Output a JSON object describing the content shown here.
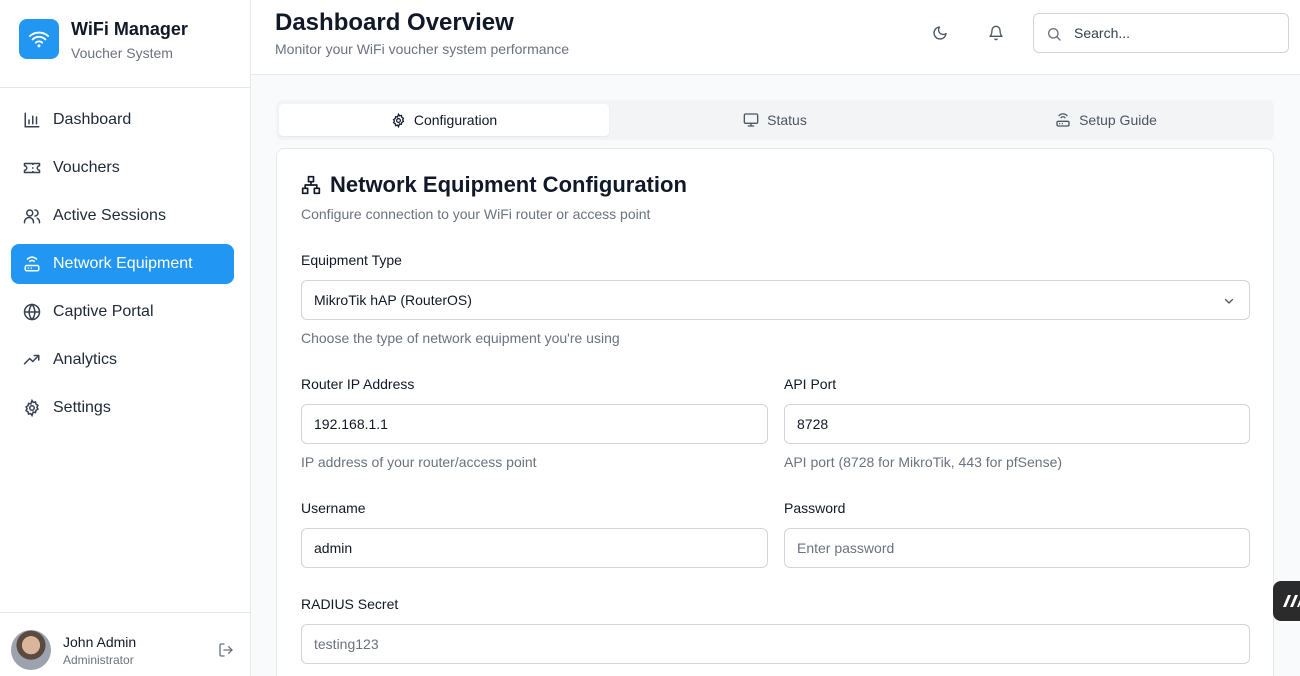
{
  "brand": {
    "title": "WiFi Manager",
    "subtitle": "Voucher System",
    "accent": "#2196f3"
  },
  "sidebar": {
    "items": [
      {
        "label": "Dashboard",
        "icon": "bar-chart-icon",
        "active": false
      },
      {
        "label": "Vouchers",
        "icon": "ticket-icon",
        "active": false
      },
      {
        "label": "Active Sessions",
        "icon": "users-icon",
        "active": false
      },
      {
        "label": "Network Equipment",
        "icon": "router-icon",
        "active": true
      },
      {
        "label": "Captive Portal",
        "icon": "globe-icon",
        "active": false
      },
      {
        "label": "Analytics",
        "icon": "trending-up-icon",
        "active": false
      },
      {
        "label": "Settings",
        "icon": "gear-icon",
        "active": false
      }
    ]
  },
  "user": {
    "name": "John Admin",
    "role": "Administrator"
  },
  "header": {
    "title": "Dashboard Overview",
    "subtitle": "Monitor your WiFi voucher system performance",
    "search_placeholder": "Search..."
  },
  "tabs": [
    {
      "label": "Configuration",
      "icon": "gear-icon",
      "active": true
    },
    {
      "label": "Status",
      "icon": "monitor-icon",
      "active": false
    },
    {
      "label": "Setup Guide",
      "icon": "router-icon",
      "active": false
    }
  ],
  "config": {
    "title": "Network Equipment Configuration",
    "description": "Configure connection to your WiFi router or access point",
    "equipment_type": {
      "label": "Equipment Type",
      "value": "MikroTik hAP (RouterOS)",
      "hint": "Choose the type of network equipment you're using"
    },
    "router_ip": {
      "label": "Router IP Address",
      "value": "192.168.1.1",
      "hint": "IP address of your router/access point"
    },
    "api_port": {
      "label": "API Port",
      "value": "8728",
      "hint": "API port (8728 for MikroTik, 443 for pfSense)"
    },
    "username": {
      "label": "Username",
      "value": "admin"
    },
    "password": {
      "label": "Password",
      "placeholder": "Enter password"
    },
    "radius_secret": {
      "label": "RADIUS Secret",
      "placeholder": "testing123"
    }
  }
}
